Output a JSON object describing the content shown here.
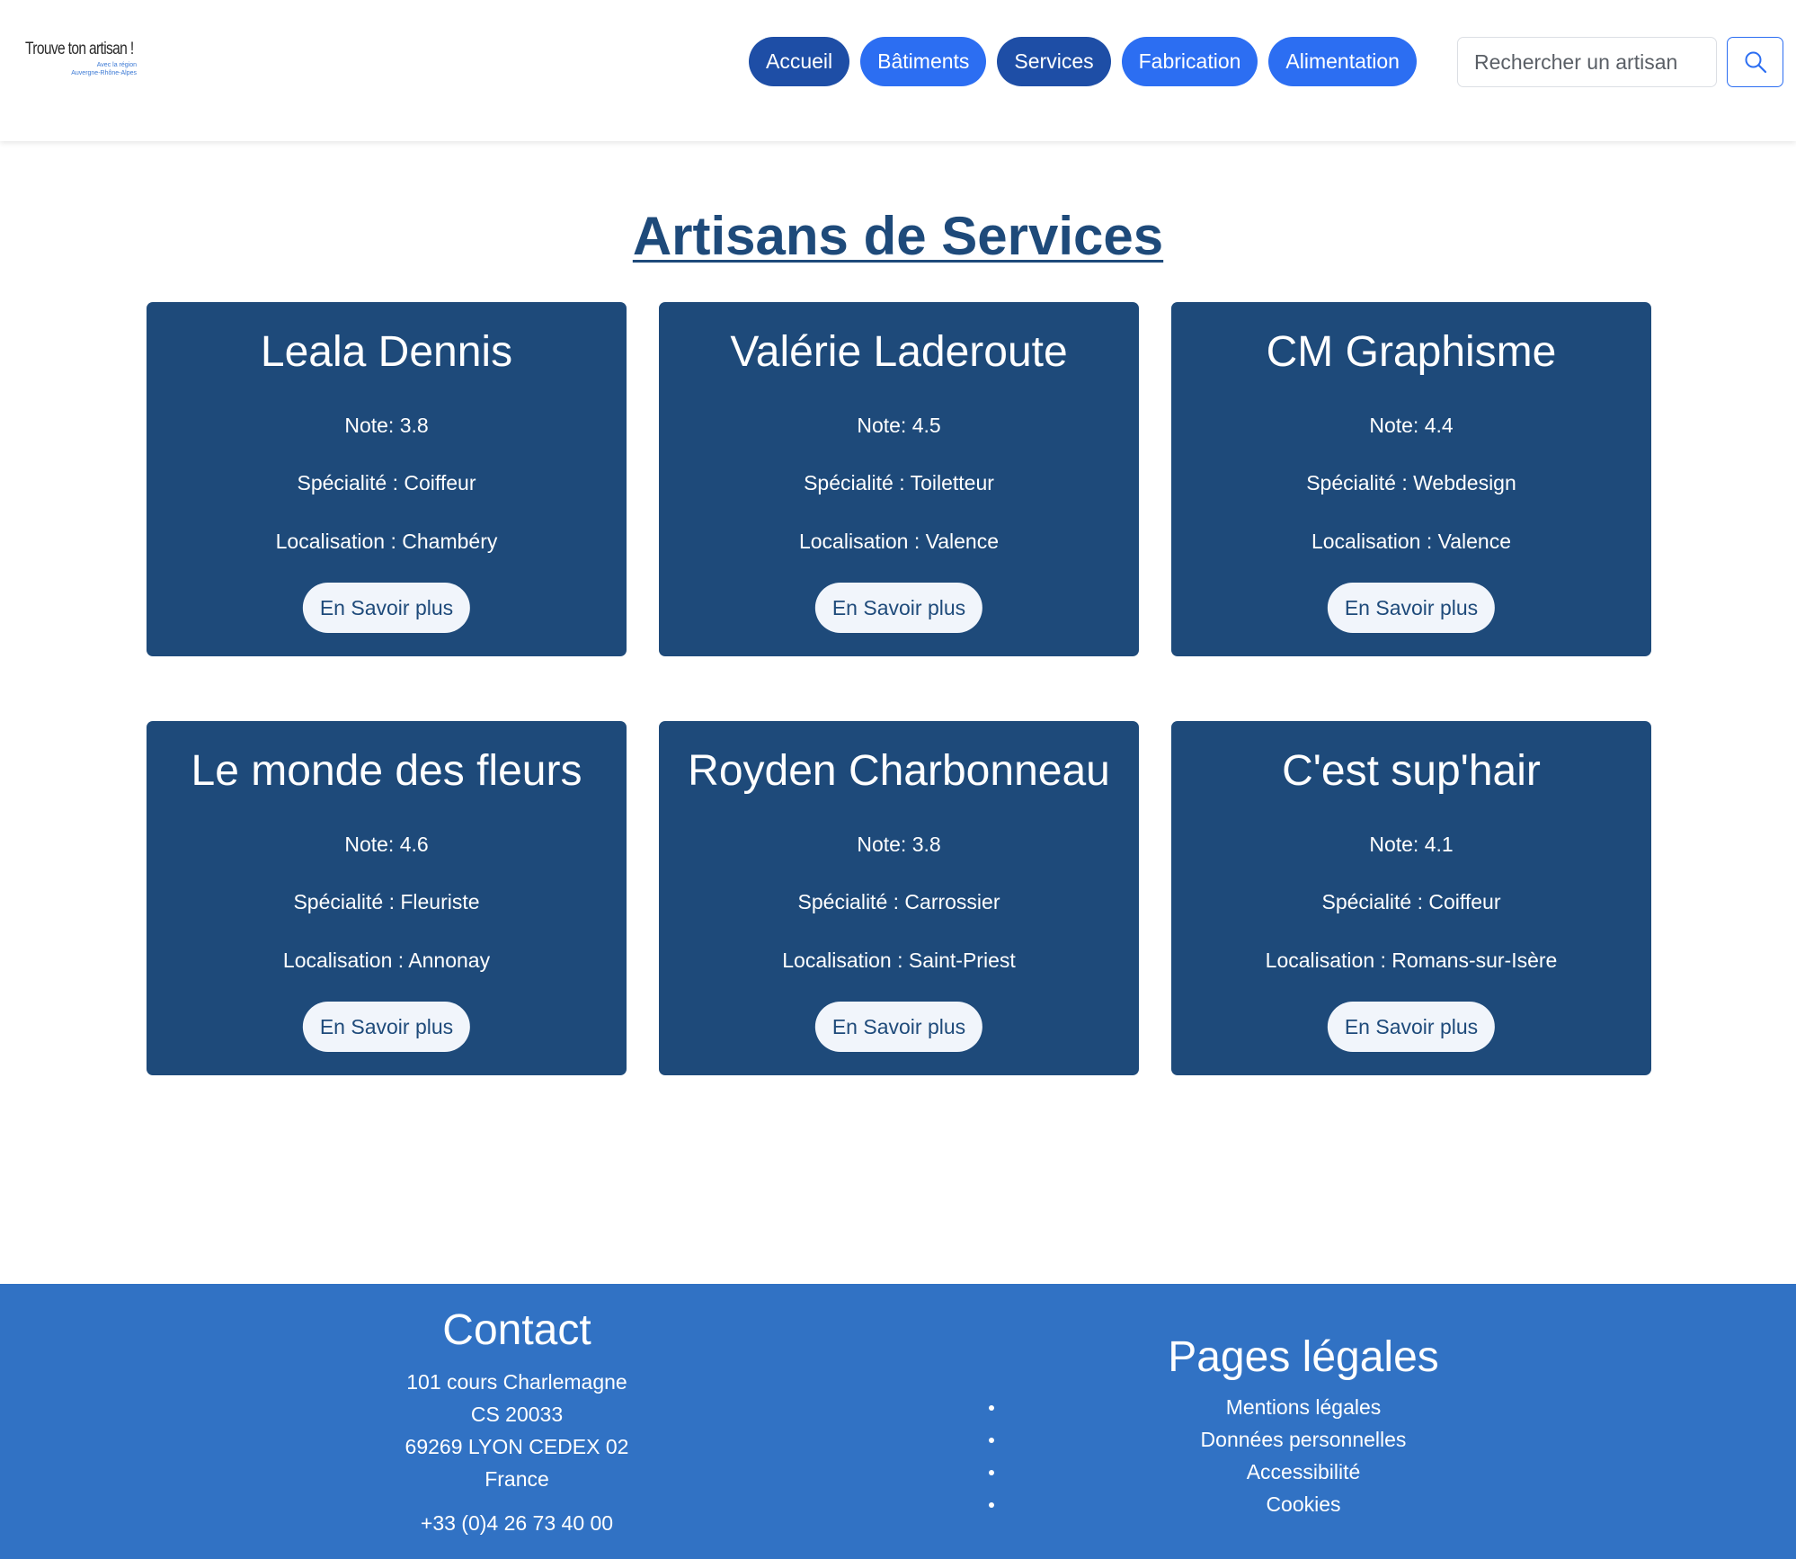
{
  "logo": {
    "title": "Trouve ton artisan !",
    "subtitle_line1": "Avec la région",
    "subtitle_line2": "Auvergne-Rhône-Alpes"
  },
  "nav": [
    {
      "label": "Accueil",
      "style": "dark"
    },
    {
      "label": "Bâtiments",
      "style": "bright"
    },
    {
      "label": "Services",
      "style": "dark"
    },
    {
      "label": "Fabrication",
      "style": "bright"
    },
    {
      "label": "Alimentation",
      "style": "bright"
    }
  ],
  "search": {
    "placeholder": "Rechercher un artisan",
    "icon": "search-icon"
  },
  "page_title": "Artisans de Services",
  "cards": [
    {
      "name": "Leala Dennis",
      "note": "Note: 3.8",
      "specialite": "Spécialité : Coiffeur",
      "localisation": "Localisation : Chambéry",
      "button": "En Savoir plus"
    },
    {
      "name": "Valérie Laderoute",
      "note": "Note: 4.5",
      "specialite": "Spécialité : Toiletteur",
      "localisation": "Localisation : Valence",
      "button": "En Savoir plus"
    },
    {
      "name": "CM Graphisme",
      "note": "Note: 4.4",
      "specialite": "Spécialité : Webdesign",
      "localisation": "Localisation : Valence",
      "button": "En Savoir plus"
    },
    {
      "name": "Le monde des fleurs",
      "note": "Note: 4.6",
      "specialite": "Spécialité : Fleuriste",
      "localisation": "Localisation : Annonay",
      "button": "En Savoir plus"
    },
    {
      "name": "Royden Charbonneau",
      "note": "Note: 3.8",
      "specialite": "Spécialité : Carrossier",
      "localisation": "Localisation : Saint-Priest",
      "button": "En Savoir plus"
    },
    {
      "name": "C'est sup'hair",
      "note": "Note: 4.1",
      "specialite": "Spécialité : Coiffeur",
      "localisation": "Localisation : Romans-sur-Isère",
      "button": "En Savoir plus"
    }
  ],
  "footer": {
    "contact": {
      "title": "Contact",
      "address": [
        "101 cours Charlemagne",
        "CS 20033",
        "69269 LYON CEDEX 02",
        "France"
      ],
      "phone": "+33 (0)4 26 73 40 00"
    },
    "legal": {
      "title": "Pages légales",
      "links": [
        "Mentions légales",
        "Données personnelles",
        "Accessibilité",
        "Cookies"
      ]
    }
  },
  "colors": {
    "nav_dark": "#1e4ea6",
    "nav_bright": "#2c6ef2",
    "card_bg": "#1e4a7a",
    "title": "#1e4a7a",
    "footer_bg": "#3172c4"
  }
}
